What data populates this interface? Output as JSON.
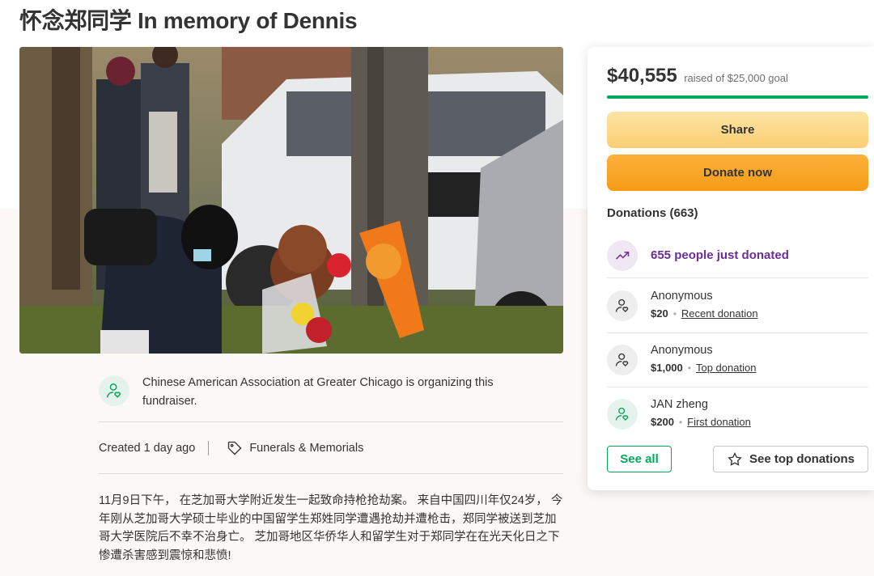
{
  "campaign": {
    "title": "怀念郑同学 In memory of Dennis"
  },
  "organizer": {
    "text": "Chinese American Association at Greater Chicago is organizing this fundraiser.",
    "icon": "user-heart-icon"
  },
  "meta": {
    "created": "Created 1 day ago",
    "category": "Funerals & Memorials",
    "category_icon": "tag-icon"
  },
  "story": {
    "text": "11月9日下午， 在芝加哥大学附近发生一起致命持枪抢劫案。 来自中国四川年仅24岁， 今年刚从芝加哥大学硕士毕业的中国留学生郑姓同学遭遇抢劫并遭枪击，郑同学被送到芝加哥大学医院后不幸不治身亡。 芝加哥地区华侨华人和留学生对于郑同学在在光天化日之下惨遭杀害感到震惊和悲愤!"
  },
  "donation_card": {
    "amount": "$40,555",
    "goal_text": "raised of $25,000 goal",
    "progress_fraction": 1.0,
    "share_label": "Share",
    "donate_label": "Donate now",
    "donations_heading": "Donations (663)",
    "trend_text": "655 people just donated",
    "trend_icon": "trending-up-icon",
    "donors": [
      {
        "name": "Anonymous",
        "amount": "$20",
        "kind": "Recent donation"
      },
      {
        "name": "Anonymous",
        "amount": "$1,000",
        "kind": "Top donation"
      },
      {
        "name": "JAN zheng",
        "amount": "$200",
        "kind": "First donation"
      }
    ],
    "see_all_label": "See all",
    "see_top_label": "See top donations",
    "see_top_icon": "star-icon"
  },
  "colors": {
    "accent_green": "#02a95c",
    "donate_orange": "#f59b16",
    "share_yellow": "#fbcf74",
    "trend_purple": "#6b2e96"
  }
}
